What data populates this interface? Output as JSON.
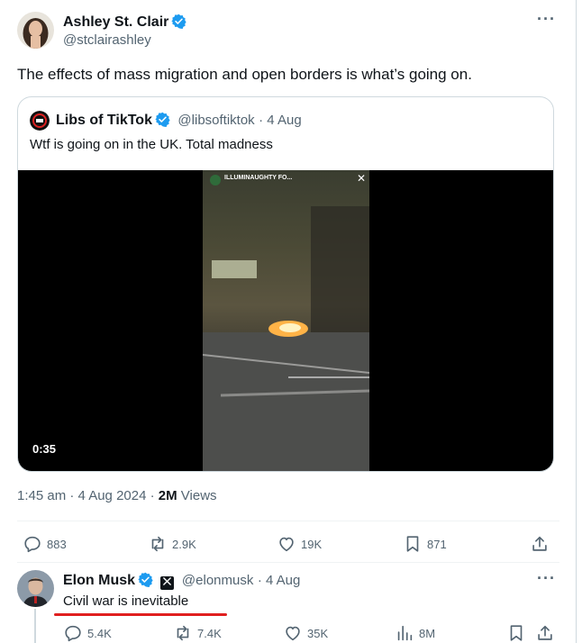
{
  "main_post": {
    "author_name": "Ashley St. Clair",
    "author_handle": "@stclairashley",
    "text": "The effects of mass migration and open borders is what’s going on.",
    "quoted": {
      "author_name": "Libs of TikTok",
      "author_handle": "@libsoftiktok",
      "date": "· 4 Aug",
      "text": "Wtf is going on in the UK. Total madness",
      "video_overlay_text": "ILLUMINAUGHTY FO...",
      "video_close": "✕",
      "video_duration": "0:35"
    },
    "timestamp": "1:45 am · 4 Aug 2024 · ",
    "views_count": "2M",
    "views_label": " Views",
    "stats": {
      "replies": "883",
      "reposts": "2.9K",
      "likes": "19K",
      "bookmarks": "871"
    }
  },
  "reply_post": {
    "author_name": "Elon Musk",
    "author_handle": "@elonmusk",
    "date": "· 4 Aug",
    "text": "Civil war is inevitable",
    "stats": {
      "replies": "5.4K",
      "reposts": "7.4K",
      "likes": "35K",
      "views": "8M"
    }
  },
  "colors": {
    "verified_blue": "#1d9bf0",
    "text_primary": "#0f1419",
    "text_secondary": "#536471",
    "highlight_red": "#e01f1f"
  },
  "icons": [
    "verified-badge-icon",
    "more-options-icon",
    "reply-icon",
    "repost-icon",
    "like-icon",
    "bookmark-icon",
    "share-icon",
    "views-icon",
    "x-logo-icon"
  ]
}
